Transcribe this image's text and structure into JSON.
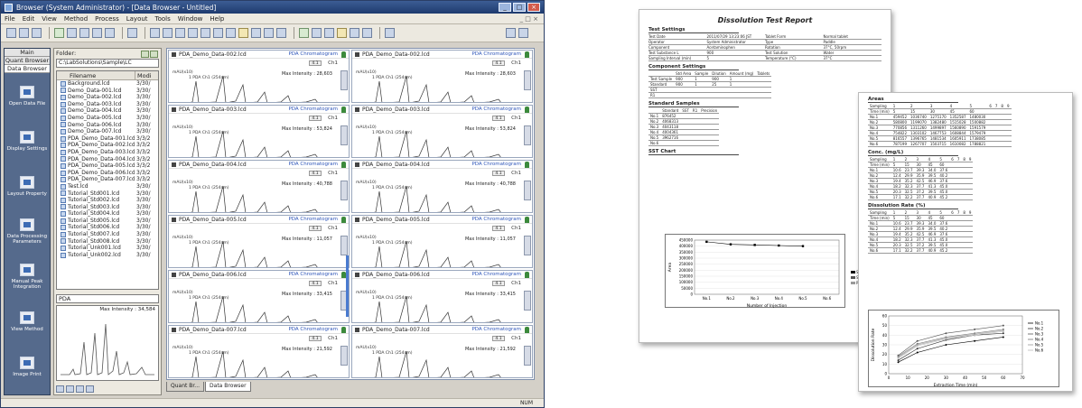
{
  "window": {
    "title": "Browser (System Administrator) - [Data Browser - Untitled]",
    "min": "_",
    "max": "□",
    "close": "×"
  },
  "menu": [
    "File",
    "Edit",
    "View",
    "Method",
    "Process",
    "Layout",
    "Tools",
    "Window",
    "Help"
  ],
  "leftnav": {
    "tabs": [
      "Main",
      "Quant Browser",
      "Data Browser"
    ],
    "items": [
      "Open Data File",
      "Display Settings",
      "Layout Property",
      "Data Processing Parameters",
      "Manual Peak Integration",
      "View Method",
      "Image Print"
    ]
  },
  "filepanel": {
    "folder_label": "Folder:",
    "path": "C:\\LabSolutions\\Sample\\LC",
    "col_name": "Filename",
    "col_date": "Modi",
    "files": [
      {
        "name": "Background.lcd",
        "date": "3/30/"
      },
      {
        "name": "Demo_Data-001.lcd",
        "date": "3/30/"
      },
      {
        "name": "Demo_Data-002.lcd",
        "date": "3/30/"
      },
      {
        "name": "Demo_Data-003.lcd",
        "date": "3/30/"
      },
      {
        "name": "Demo_Data-004.lcd",
        "date": "3/30/"
      },
      {
        "name": "Demo_Data-005.lcd",
        "date": "3/30/"
      },
      {
        "name": "Demo_Data-006.lcd",
        "date": "3/30/"
      },
      {
        "name": "Demo_Data-007.lcd",
        "date": "3/30/"
      },
      {
        "name": "PDA_Demo_Data-001.lcd",
        "date": "3/3/2"
      },
      {
        "name": "PDA_Demo_Data-002.lcd",
        "date": "3/3/2"
      },
      {
        "name": "PDA_Demo_Data-003.lcd",
        "date": "3/3/2"
      },
      {
        "name": "PDA_Demo_Data-004.lcd",
        "date": "3/3/2"
      },
      {
        "name": "PDA_Demo_Data-005.lcd",
        "date": "3/3/2"
      },
      {
        "name": "PDA_Demo_Data-006.lcd",
        "date": "3/3/2"
      },
      {
        "name": "PDA_Demo_Data-007.lcd",
        "date": "3/3/2"
      },
      {
        "name": "Test.lcd",
        "date": "3/30/"
      },
      {
        "name": "Tutorial_Std001.lcd",
        "date": "3/30/"
      },
      {
        "name": "Tutorial_Std002.lcd",
        "date": "3/30/"
      },
      {
        "name": "Tutorial_Std003.lcd",
        "date": "3/30/"
      },
      {
        "name": "Tutorial_Std004.lcd",
        "date": "3/30/"
      },
      {
        "name": "Tutorial_Std005.lcd",
        "date": "3/30/"
      },
      {
        "name": "Tutorial_Std006.lcd",
        "date": "3/30/"
      },
      {
        "name": "Tutorial_Std007.lcd",
        "date": "3/30/"
      },
      {
        "name": "Tutorial_Std008.lcd",
        "date": "3/30/"
      },
      {
        "name": "Tutorial_Unk001.lcd",
        "date": "3/30/"
      },
      {
        "name": "Tutorial_Unk002.lcd",
        "date": "3/30/"
      }
    ],
    "pda_select": "PDA",
    "pda_maxint": "Max Intensity : 34,584"
  },
  "chrom": {
    "type_label": "PDA Chromatogram",
    "ch": "Ch1",
    "ch_prefix": "Ch",
    "badge": "4.1",
    "yunit": "mAU(x10)",
    "trace": "1 PDA Ch1 (254nm)",
    "cells": [
      {
        "name": "PDA_Demo_Data-002.lcd",
        "maxint": "Max Intensity : 28,603"
      },
      {
        "name": "PDA_Demo_Data-002.lcd",
        "maxint": "Max Intensity : 28,603"
      },
      {
        "name": "PDA_Demo_Data-003.lcd",
        "maxint": "Max Intensity : 53,824"
      },
      {
        "name": "PDA_Demo_Data-003.lcd",
        "maxint": "Max Intensity : 53,824"
      },
      {
        "name": "PDA_Demo_Data-004.lcd",
        "maxint": "Max Intensity : 40,788"
      },
      {
        "name": "PDA_Demo_Data-004.lcd",
        "maxint": "Max Intensity : 40,788"
      },
      {
        "name": "PDA_Demo_Data-005.lcd",
        "maxint": "Max Intensity : 11,057"
      },
      {
        "name": "PDA_Demo_Data-005.lcd",
        "maxint": "Max Intensity : 11,057"
      },
      {
        "name": "PDA_Demo_Data-006.lcd",
        "maxint": "Max Intensity : 33,415"
      },
      {
        "name": "PDA_Demo_Data-006.lcd",
        "maxint": "Max Intensity : 33,415"
      },
      {
        "name": "PDA_Demo_Data-007.lcd",
        "maxint": "Max Intensity : 21,592"
      },
      {
        "name": "PDA_Demo_Data-007.lcd",
        "maxint": "Max Intensity : 21,592"
      }
    ]
  },
  "bottomtabs": [
    "Quant Br...",
    "Data Browser"
  ],
  "status": "NUM",
  "report1": {
    "title": "Dissolution Test Report",
    "sec_test": "Test Settings",
    "test_rows": [
      [
        "Test Date",
        "2011/07/29 13:23:06 JST",
        "Tablet Form",
        "Normal tablet"
      ],
      [
        "Operator",
        "System Administrator",
        "Type",
        "Paddle"
      ],
      [
        "Component",
        "Acetaminophen",
        "Rotation",
        "37°C, 50rpm"
      ],
      [
        "Test Substance L",
        "900",
        "Test Solution",
        "Water"
      ],
      [
        "Sampling Interval (min)",
        "5",
        "Temperature (°C)",
        "37°C"
      ]
    ],
    "sec_comp": "Component Settings",
    "comp_header": [
      "",
      "Std Area",
      "Sample",
      "Dilution",
      "Amount (mg)",
      "Tablets"
    ],
    "comp_rows": [
      [
        "Test Sample",
        "900",
        "1",
        "900",
        "1",
        ""
      ],
      [
        "Standard",
        "900",
        "1",
        "25",
        "1",
        ""
      ],
      [
        "SST",
        "",
        "",
        "",
        "",
        ""
      ],
      [
        "R1",
        "",
        "",
        "",
        "",
        ""
      ]
    ],
    "sec_std": "Standard Samples",
    "std_header": [
      "",
      "Standard",
      "SST",
      "R1",
      "Precision"
    ],
    "std_rows": [
      [
        "No.1",
        "876452",
        "",
        "",
        ""
      ],
      [
        "No.2",
        "4068313",
        "",
        "",
        ""
      ],
      [
        "No.3",
        "4043118",
        "",
        "",
        ""
      ],
      [
        "No.4",
        "4004361",
        "",
        "",
        ""
      ],
      [
        "No.5",
        "3962716",
        "",
        "",
        ""
      ],
      [
        "No.6",
        "",
        "",
        "",
        ""
      ]
    ],
    "sec_sst": "SST Chart",
    "chart": {
      "type": "line",
      "categories": [
        "No.1",
        "No.2",
        "No.3",
        "No.4",
        "No.5",
        "No.6"
      ],
      "series": [
        {
          "name": "Standard",
          "values": [
            436000,
            415000,
            410000,
            405000,
            400000,
            null
          ]
        },
        {
          "name": "SST",
          "values": [
            null,
            null,
            null,
            null,
            null,
            null
          ]
        },
        {
          "name": "R1",
          "values": [
            null,
            null,
            null,
            null,
            null,
            null
          ]
        }
      ],
      "ylim": [
        0,
        450000
      ],
      "yticks": [
        "450000",
        "400000",
        "350000",
        "300000",
        "250000",
        "200000",
        "150000",
        "100000",
        "50000",
        "0"
      ],
      "xlabel": "Number of Injection",
      "ylabel": "Area"
    }
  },
  "report2": {
    "sec_area": "Areas",
    "sec_conc": "Conc. (mg/L)",
    "sec_diss": "Dissolution Rate (%)",
    "cols": [
      "Sampling",
      "1",
      "2",
      "3",
      "4",
      "5",
      "6",
      "7",
      "8",
      "9"
    ],
    "times": [
      "Time (min)",
      "5",
      "15",
      "30",
      "45",
      "60",
      "",
      "",
      "",
      ""
    ],
    "area_rows": [
      [
        "No.1",
        "459452",
        "1036740",
        "1275170",
        "1352587",
        "1480030",
        "",
        "",
        "",
        ""
      ],
      [
        "No.2",
        "580800",
        "1199070",
        "1382480",
        "1515028",
        "1500882",
        "",
        "",
        "",
        ""
      ],
      [
        "No.3",
        "770856",
        "1311260",
        "1499897",
        "1560890",
        "1591579",
        "",
        "",
        "",
        ""
      ],
      [
        "No.4",
        "754822",
        "1303102",
        "1467753",
        "1608844",
        "1579479",
        "",
        "",
        "",
        ""
      ],
      [
        "No.5",
        "816557",
        "1396765",
        "1481534",
        "1605911",
        "1738085",
        "",
        "",
        "",
        ""
      ],
      [
        "No.6",
        "787199",
        "1267707",
        "1503715",
        "1610082",
        "1788821",
        "",
        "",
        "",
        ""
      ]
    ],
    "diss_rows": [
      [
        "No.1",
        "10.6",
        "23.7",
        "39.3",
        "34.0",
        "37.6",
        "",
        "",
        "",
        ""
      ],
      [
        "No.2",
        "12.4",
        "29.9",
        "35.9",
        "39.5",
        "40.2",
        "",
        "",
        "",
        ""
      ],
      [
        "No.3",
        "19.4",
        "35.2",
        "42.5",
        "46.9",
        "37.6",
        "",
        "",
        "",
        ""
      ],
      [
        "No.4",
        "18.2",
        "32.3",
        "37.7",
        "41.3",
        "45.0",
        "",
        "",
        "",
        ""
      ],
      [
        "No.5",
        "20.3",
        "32.5",
        "37.2",
        "39.5",
        "45.0",
        "",
        "",
        "",
        ""
      ],
      [
        "No.6",
        "17.1",
        "32.2",
        "37.7",
        "40.9",
        "45.2",
        "",
        "",
        "",
        ""
      ]
    ],
    "chart": {
      "type": "line",
      "x": [
        5,
        15,
        30,
        45,
        60
      ],
      "series": [
        {
          "name": "No.1",
          "values": [
            12,
            22,
            30,
            34,
            38
          ]
        },
        {
          "name": "No.2",
          "values": [
            14,
            26,
            35,
            40,
            42
          ]
        },
        {
          "name": "No.3",
          "values": [
            19,
            34,
            42,
            46,
            50
          ]
        },
        {
          "name": "No.4",
          "values": [
            18,
            31,
            38,
            42,
            46
          ]
        },
        {
          "name": "No.5",
          "values": [
            17,
            30,
            37,
            41,
            45
          ]
        },
        {
          "name": "No.6",
          "values": [
            16,
            29,
            36,
            40,
            44
          ]
        }
      ],
      "xlim": [
        0,
        70
      ],
      "ylim": [
        0,
        60
      ],
      "xticks": [
        "0",
        "10",
        "20",
        "30",
        "40",
        "50",
        "60",
        "70"
      ],
      "yticks": [
        "60",
        "50",
        "40",
        "30",
        "20",
        "10",
        "0"
      ],
      "xlabel": "Extraction Time (min)",
      "ylabel": "Dissolution Rate"
    }
  }
}
